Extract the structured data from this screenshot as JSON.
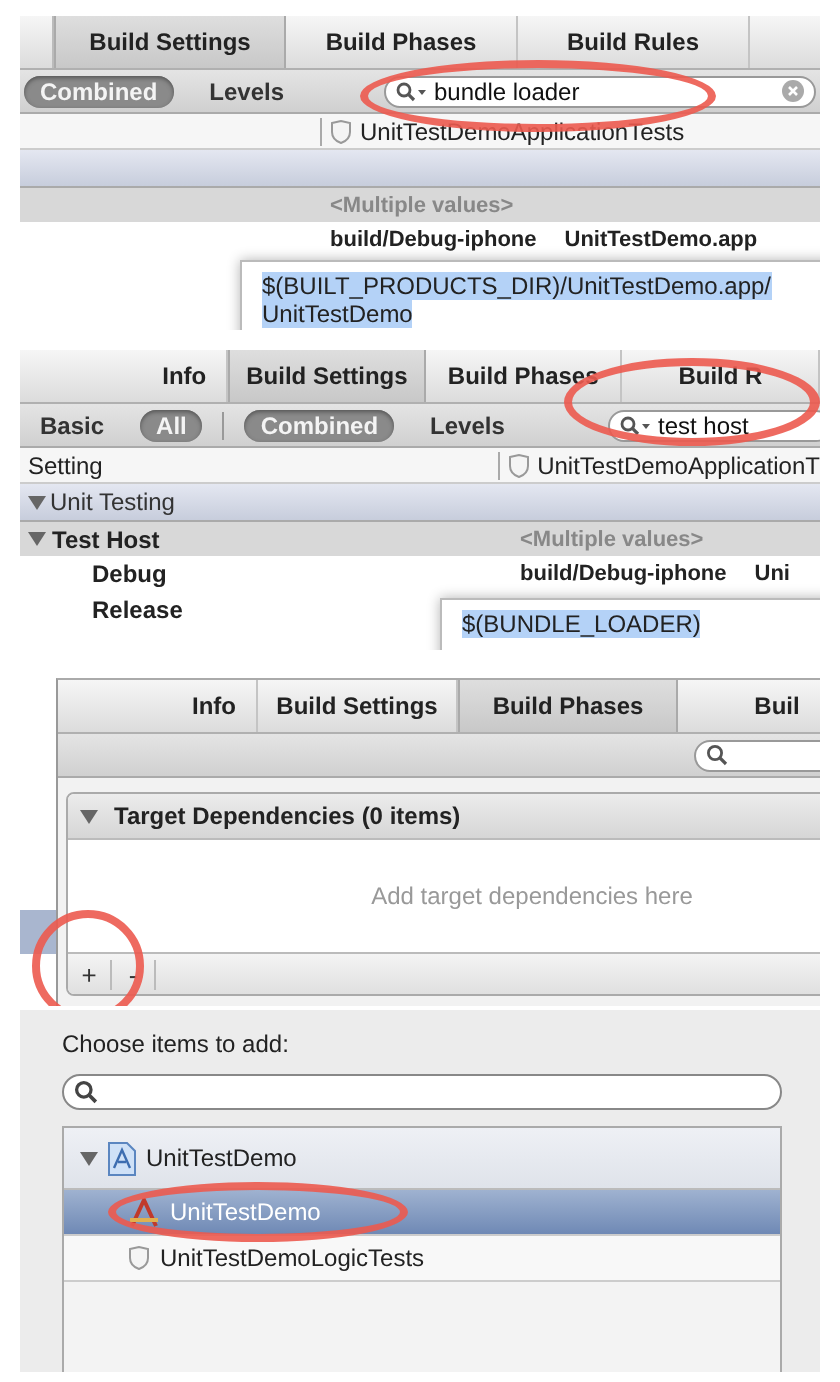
{
  "bundle_loader_panel": {
    "tabs": [
      {
        "label": "Build Settings",
        "selected": true
      },
      {
        "label": "Build Phases",
        "selected": false
      },
      {
        "label": "Build Rules",
        "selected": false
      }
    ],
    "filters": [
      {
        "label": "Combined",
        "selected": true
      },
      {
        "label": "Levels",
        "selected": false
      }
    ],
    "search": {
      "value": "bundle loader"
    },
    "target_column": "UnitTestDemoApplicationTests",
    "summary": "<Multiple values>",
    "value_start": "build/Debug-iphone",
    "value_end": "UnitTestDemo.app",
    "editor_lines": [
      "$(BUILT_PRODUCTS_DIR)/UnitTestDemo.app/",
      "UnitTestDemo"
    ]
  },
  "test_host_panel": {
    "tabs": [
      {
        "label": "Info",
        "selected": false
      },
      {
        "label": "Build Settings",
        "selected": true
      },
      {
        "label": "Build Phases",
        "selected": false
      },
      {
        "label": "Build R",
        "selected": false
      }
    ],
    "levels": [
      {
        "label": "Basic",
        "selected": false
      },
      {
        "label": "All",
        "selected": true
      }
    ],
    "filters": [
      {
        "label": "Combined",
        "selected": true
      },
      {
        "label": "Levels",
        "selected": false
      }
    ],
    "search": {
      "value": "test host"
    },
    "setting_column": "Setting",
    "target_column": "UnitTestDemoApplicationT",
    "section": {
      "label": "Unit Testing",
      "expanded": true
    },
    "setting": {
      "label": "Test Host",
      "expanded": true,
      "value": "<Multiple values>",
      "configurations": [
        {
          "label": "Debug",
          "value_start": "build/Debug-iphone",
          "value_end": "Uni"
        },
        {
          "label": "Release"
        }
      ]
    },
    "editor_lines": [
      "$(BUNDLE_LOADER)"
    ]
  },
  "target_dependencies_panel": {
    "tabs": [
      {
        "label": "Info",
        "selected": false
      },
      {
        "label": "Build Settings",
        "selected": false
      },
      {
        "label": "Build Phases",
        "selected": true
      },
      {
        "label": "Buil",
        "selected": false
      }
    ],
    "phase": {
      "label": "Target Dependencies (0 items)",
      "expanded": true
    },
    "empty_message": "Add target dependencies here",
    "buttons": [
      "+",
      "-"
    ]
  },
  "choose_items_panel": {
    "prompt": "Choose items to add:",
    "tree": [
      {
        "kind": "project",
        "label": "UnitTestDemo",
        "expanded": true,
        "selected": false,
        "children": [
          {
            "kind": "app",
            "label": "UnitTestDemo",
            "selected": true
          },
          {
            "kind": "tests",
            "label": "UnitTestDemoLogicTests",
            "selected": false
          }
        ]
      }
    ]
  }
}
